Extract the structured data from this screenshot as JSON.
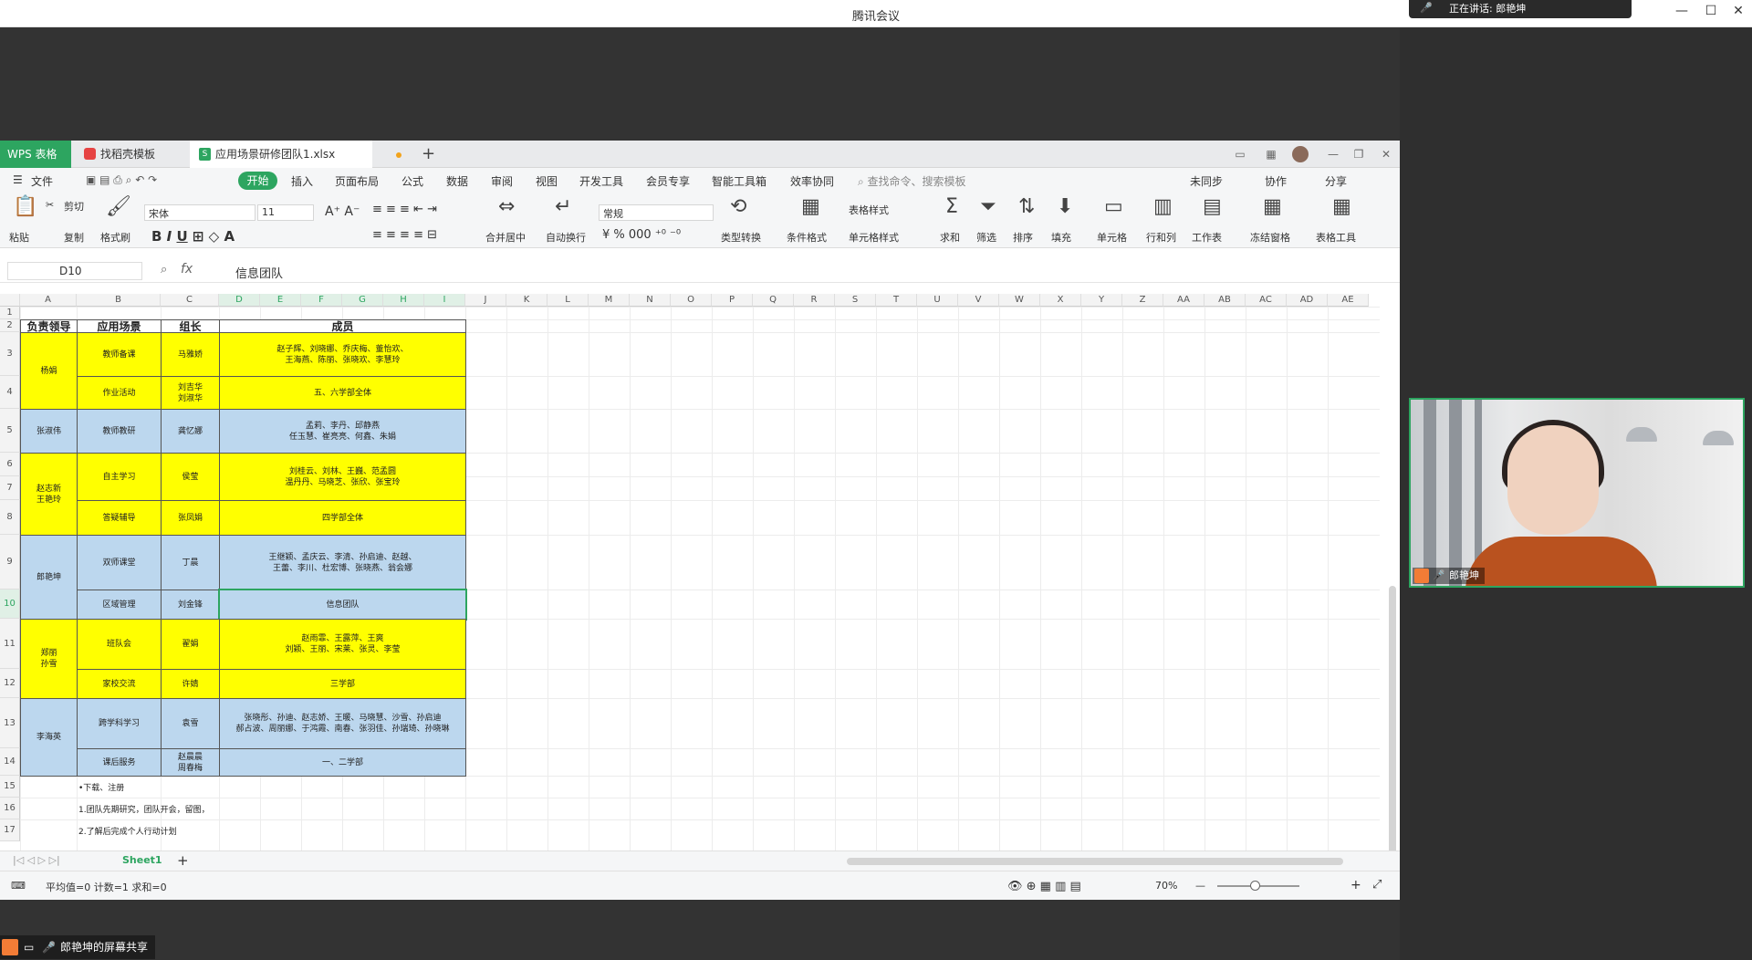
{
  "meeting": {
    "title": "腾讯会议",
    "speaking": "正在讲话: 郎艳坤",
    "participant_name": "郎艳坤",
    "share_label": "郎艳坤的屏幕共享"
  },
  "wps": {
    "brand": "WPS 表格",
    "tab_template": "找稻壳模板",
    "tab_file": "应用场景研修团队1.xlsx",
    "menus": [
      "文件",
      "开始",
      "插入",
      "页面布局",
      "公式",
      "数据",
      "审阅",
      "视图",
      "开发工具",
      "会员专享",
      "智能工具箱",
      "效率协同"
    ],
    "search_placeholder": "查找命令、搜索模板",
    "right_menus": [
      "未同步",
      "协作",
      "分享"
    ],
    "ribbon": {
      "paste": "粘贴",
      "cut": "剪切",
      "copy": "复制",
      "format_painter": "格式刷",
      "font": "宋体",
      "font_size": "11",
      "merge_center": "合并居中",
      "wrap": "自动换行",
      "number_format": "常规",
      "type_convert": "类型转换",
      "cond_format": "条件格式",
      "table_style": "表格样式",
      "cell_style": "单元格样式",
      "sum": "求和",
      "filter": "筛选",
      "sort": "排序",
      "fill": "填充",
      "cell": "单元格",
      "row_col": "行和列",
      "worksheet": "工作表",
      "freeze": "冻结窗格",
      "table_tools": "表格工具"
    },
    "namebox": "D10",
    "formula_value": "信息团队",
    "sheet_tab": "Sheet1",
    "status": {
      "stats": "平均值=0  计数=1  求和=0",
      "zoom": "70%"
    }
  },
  "sheet": {
    "columns": [
      "A",
      "B",
      "C",
      "D",
      "E",
      "F",
      "G",
      "H",
      "I",
      "J",
      "K",
      "L",
      "M",
      "N",
      "O",
      "P",
      "Q",
      "R",
      "S",
      "T",
      "U",
      "V",
      "W",
      "X",
      "Y",
      "Z",
      "AA",
      "AB",
      "AC",
      "AD",
      "AE"
    ],
    "rows": [
      "1",
      "2",
      "3",
      "4",
      "5",
      "6",
      "7",
      "8",
      "9",
      "10",
      "11",
      "12",
      "13",
      "14",
      "15",
      "16",
      "17"
    ],
    "headers": [
      "负责领导",
      "应用场景",
      "组长",
      "成员"
    ],
    "leaders": [
      "杨娟",
      "张淑伟",
      "赵志新\n王艳玲",
      "郎艳坤",
      "郑丽\n孙雪",
      "李海英"
    ],
    "scenes": [
      "教师备课",
      "作业活动",
      "教师教研",
      "自主学习",
      "答疑辅导",
      "双师课堂",
      "区域管理",
      "班队会",
      "家校交流",
      "跨学科学习",
      "课后服务"
    ],
    "group_leaders": [
      "马雅娇",
      "刘吉华\n刘淑华",
      "龚忆娜",
      "侯莹",
      "张凤娟",
      "丁晨",
      "刘金锋",
      "翟娟",
      "许婧",
      "袁雪",
      "赵晨晨\n周春梅"
    ],
    "members": [
      "赵子辉、刘晓娜、乔庆梅、董怡欢、\n王海燕、陈丽、张晓欢、李慧玲",
      "五、六学部全体",
      "孟莉、李丹、邱静燕\n任玉慧、崔亮亮、何鑫、朱娟",
      "刘桂云、刘林、王巍、范孟圆\n温丹丹、马晓芝、张欣、张宝玲",
      "四学部全体",
      "王继颖、孟庆云、李清、孙启迪、赵越、\n王蕾、李川、杜宏博、张晓燕、翁会娜",
      "信息团队",
      "赵雨霏、王露萍、王爽\n刘颖、王丽、宋莱、张灵、李莹",
      "三学部",
      "张晓彤、孙迪、赵志娇、王暖、马晓慧、沙雪、孙启迪\n郝占波、周丽娜、于鸿霞、南春、张羽佳、孙瑞琦、孙晓琳",
      "一、二学部"
    ],
    "notes": [
      "•下载、注册",
      "1.团队先期研究，团队开会，留图，",
      "2.了解后完成个人行动计划"
    ]
  }
}
